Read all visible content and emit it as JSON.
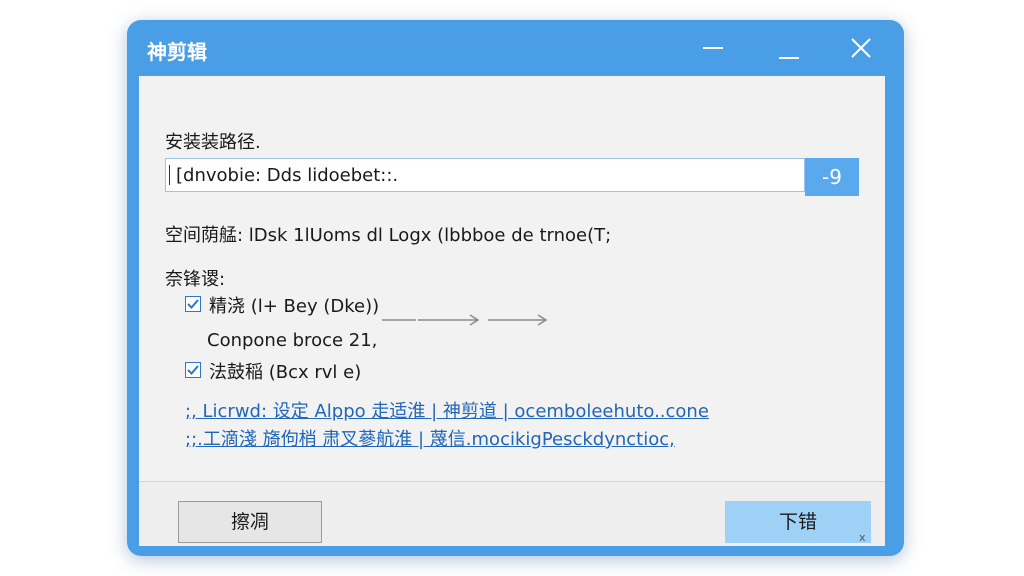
{
  "window": {
    "title": "神剪辑",
    "accent_color": "#4a9ee6",
    "controls": {
      "minimize_icon": "minimize-icon",
      "maximize_icon": "maximize-icon",
      "close_icon": "close-icon"
    }
  },
  "install": {
    "path_label": "安装装路径.",
    "path_value": "[dnvobie: Dds lidoebet::.",
    "browse_label": "-9"
  },
  "space": {
    "text": "空间荫艋: lDsk 1lUoms dl Logx (lbbboe de trnoe(T;"
  },
  "options": {
    "heading": "奈锋谡:",
    "items": [
      {
        "label": "精浇 (l+ Bey (Dke))",
        "checked": true
      },
      {
        "label": "法鼓稲 (Bcx rvl e)",
        "checked": true
      }
    ],
    "component_text": "Conpone broce 21,"
  },
  "links": [
    {
      "text": ";, Licrwd: 设定 Alppo 走适淮 | 神剪道 | ocemboleehuto..cone"
    },
    {
      "text": ";;.工滴淺 旖佝梢 肃叉蔘航淮 | 蔑信.mocikigPesckdynctioc,"
    }
  ],
  "footer": {
    "cancel_label": "擦凋",
    "ok_label": "下错",
    "grip_text": "x"
  }
}
